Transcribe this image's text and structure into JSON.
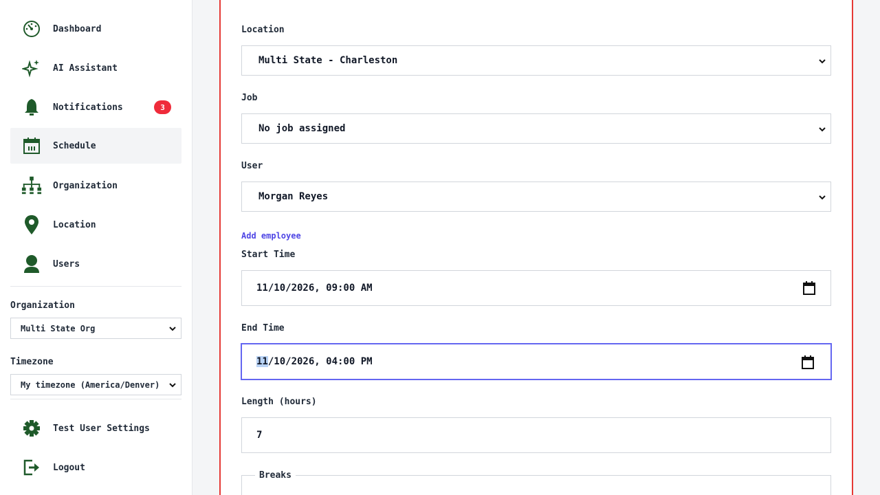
{
  "sidebar": {
    "items": [
      {
        "label": "Dashboard",
        "icon": "dashboard-icon"
      },
      {
        "label": "AI Assistant",
        "icon": "sparkle-icon"
      },
      {
        "label": "Notifications",
        "icon": "bell-icon",
        "badge": "3"
      },
      {
        "label": "Schedule",
        "icon": "calendar-icon",
        "active": true
      },
      {
        "label": "Organization",
        "icon": "org-chart-icon"
      },
      {
        "label": "Location",
        "icon": "map-pin-icon"
      },
      {
        "label": "Users",
        "icon": "user-icon"
      }
    ],
    "organization": {
      "label": "Organization",
      "value": "Multi State Org"
    },
    "timezone": {
      "label": "Timezone",
      "value": "My timezone (America/Denver)"
    },
    "footer": [
      {
        "label": "Test User Settings",
        "icon": "gear-icon"
      },
      {
        "label": "Logout",
        "icon": "logout-icon"
      }
    ]
  },
  "form": {
    "location": {
      "label": "Location",
      "value": "Multi State - Charleston"
    },
    "job": {
      "label": "Job",
      "value": "No job assigned"
    },
    "user": {
      "label": "User",
      "value": "Morgan Reyes"
    },
    "add_employee": "Add employee",
    "start_time": {
      "label": "Start Time",
      "value": "11/10/2026, 09:00 AM"
    },
    "end_time": {
      "label": "End Time",
      "month": "11",
      "rest": "/10/2026, 04:00 PM"
    },
    "length": {
      "label": "Length (hours)",
      "value": "7"
    },
    "breaks": {
      "label": "Breaks"
    }
  },
  "colors": {
    "icon_green": "#1f5a2a",
    "accent": "#4f46e5",
    "badge": "#ef2b3a",
    "frame": "#e53935",
    "focus": "#6366f1"
  }
}
